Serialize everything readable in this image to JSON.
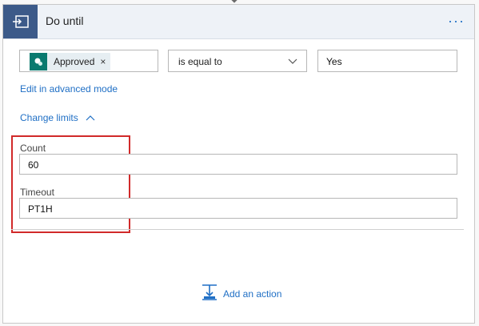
{
  "header": {
    "title": "Do until",
    "more_label": "···"
  },
  "condition": {
    "token_label": "Approved",
    "token_remove": "×",
    "operator": "is equal to",
    "value": "Yes"
  },
  "links": {
    "advanced_mode": "Edit in advanced mode",
    "change_limits": "Change limits"
  },
  "limits": {
    "count_label": "Count",
    "count_value": "60",
    "timeout_label": "Timeout",
    "timeout_value": "PT1H"
  },
  "actions": {
    "add_action": "Add an action"
  },
  "colors": {
    "header_icon_bg": "#3c5a89",
    "accent_link": "#1f6fc5",
    "highlight_border": "#d12a2a",
    "token_icon_bg": "#0a7a6f"
  },
  "icons": {
    "header": "do-until-loop-icon",
    "token": "sharepoint-icon",
    "operator": "chevron-down-icon",
    "change_limits": "chevron-up-icon",
    "add_action": "add-action-icon"
  }
}
